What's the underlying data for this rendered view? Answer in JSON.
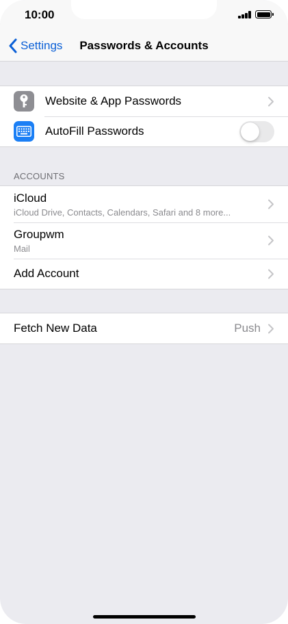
{
  "status_bar": {
    "time": "10:00"
  },
  "nav": {
    "back_label": "Settings",
    "title": "Passwords & Accounts"
  },
  "passwords_group": {
    "website_passwords": {
      "label": "Website & App Passwords",
      "icon": "key-icon",
      "icon_color": "#8e8e93"
    },
    "autofill": {
      "label": "AutoFill Passwords",
      "icon": "keyboard-icon",
      "icon_color": "#1b7ff5",
      "enabled": false
    }
  },
  "accounts": {
    "header": "ACCOUNTS",
    "items": [
      {
        "title": "iCloud",
        "subtitle": "iCloud Drive, Contacts, Calendars, Safari and 8 more..."
      },
      {
        "title": "Groupwm",
        "subtitle": "Mail"
      },
      {
        "title": "Add Account",
        "subtitle": ""
      }
    ]
  },
  "fetch": {
    "label": "Fetch New Data",
    "value": "Push"
  },
  "colors": {
    "accent": "#0a5fd6",
    "background": "#ebebf0",
    "secondary_text": "#8a8a8e"
  }
}
